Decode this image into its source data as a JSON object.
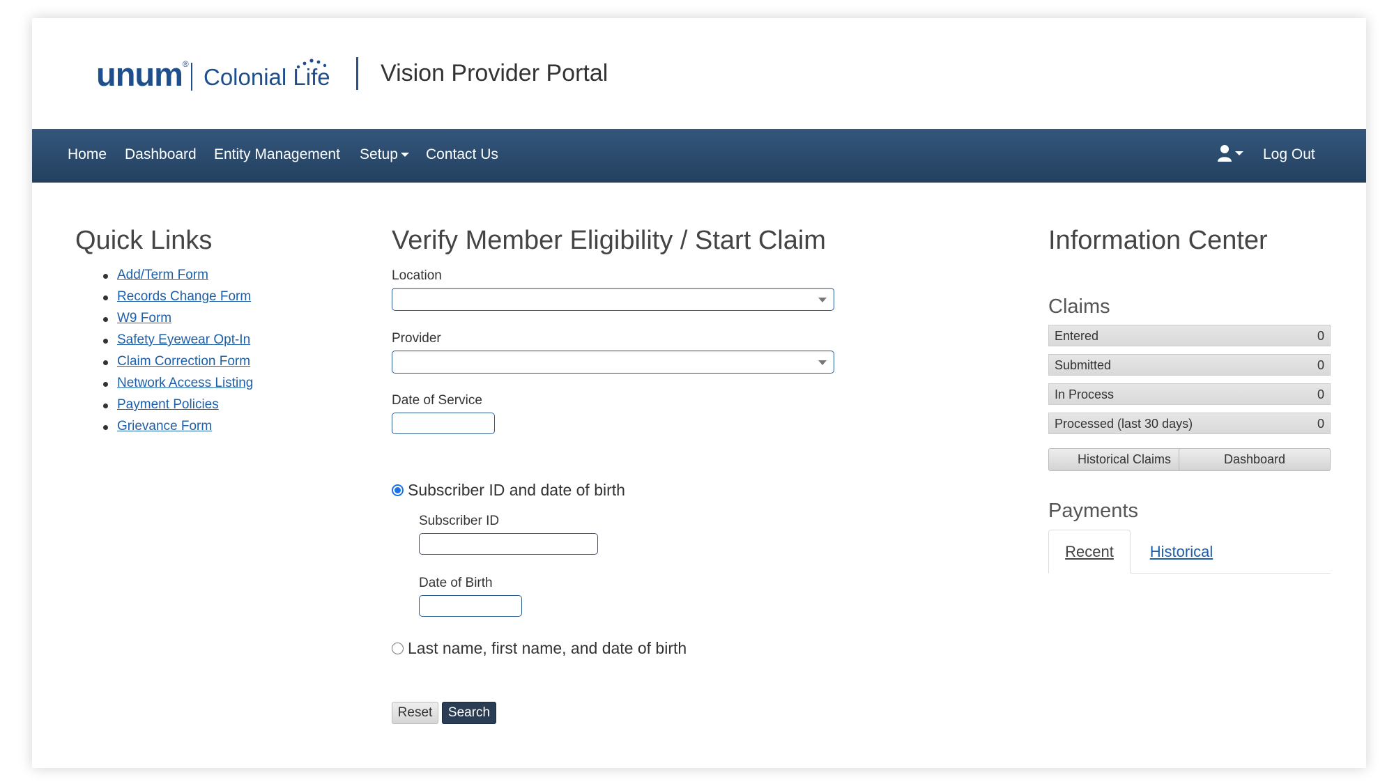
{
  "header": {
    "logo_unum": "unum",
    "logo_trademark": "®",
    "logo_colonial": "Colonial Life",
    "portal_title": "Vision Provider Portal"
  },
  "nav": {
    "home": "Home",
    "dashboard": "Dashboard",
    "entity_management": "Entity Management",
    "setup": "Setup",
    "contact_us": "Contact Us",
    "log_out": "Log Out"
  },
  "quick_links": {
    "title": "Quick Links",
    "items": [
      "Add/Term Form",
      "Records Change Form",
      "W9 Form",
      "Safety Eyewear Opt-In",
      "Claim Correction Form",
      "Network Access Listing",
      "Payment Policies",
      "Grievance Form"
    ]
  },
  "form": {
    "title": "Verify Member Eligibility / Start Claim",
    "location_label": "Location",
    "location_value": "",
    "provider_label": "Provider",
    "provider_value": "",
    "date_of_service_label": "Date of Service",
    "date_of_service_value": "",
    "option_subscriber": "Subscriber ID and date of birth",
    "subscriber_id_label": "Subscriber ID",
    "subscriber_id_value": "",
    "dob_label": "Date of Birth",
    "dob_value": "",
    "option_name": "Last name, first name, and date of birth",
    "reset_label": "Reset",
    "search_label": "Search"
  },
  "info_center": {
    "title": "Information Center",
    "claims_title": "Claims",
    "claims": [
      {
        "label": "Entered",
        "count": "0"
      },
      {
        "label": "Submitted",
        "count": "0"
      },
      {
        "label": "In Process",
        "count": "0"
      },
      {
        "label": "Processed (last 30 days)",
        "count": "0"
      }
    ],
    "historical_claims_label": "Historical Claims",
    "dashboard_label": "Dashboard",
    "payments_title": "Payments",
    "tab_recent": "Recent",
    "tab_historical": "Historical"
  },
  "colors": {
    "nav_bg": "#2c4a6e",
    "link": "#1d5fa8",
    "brand": "#1f4e8c",
    "search_button": "#2a3d55"
  }
}
